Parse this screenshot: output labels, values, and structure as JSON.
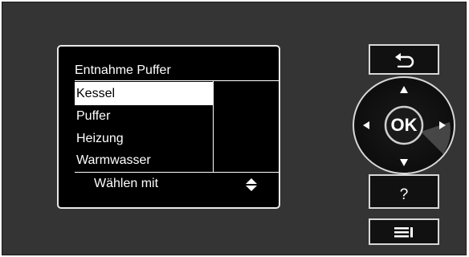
{
  "screen": {
    "title": "Entnahme Puffer",
    "items": [
      {
        "label": "Kessel",
        "selected": true
      },
      {
        "label": "Puffer",
        "selected": false
      },
      {
        "label": "Heizung",
        "selected": false
      },
      {
        "label": "Warmwasser",
        "selected": false
      }
    ],
    "footer": "Wählen mit"
  },
  "controls": {
    "ok_label": "OK",
    "help_label": "?",
    "back_icon": "back-arrow-icon",
    "menu_icon": "menu-icon"
  }
}
